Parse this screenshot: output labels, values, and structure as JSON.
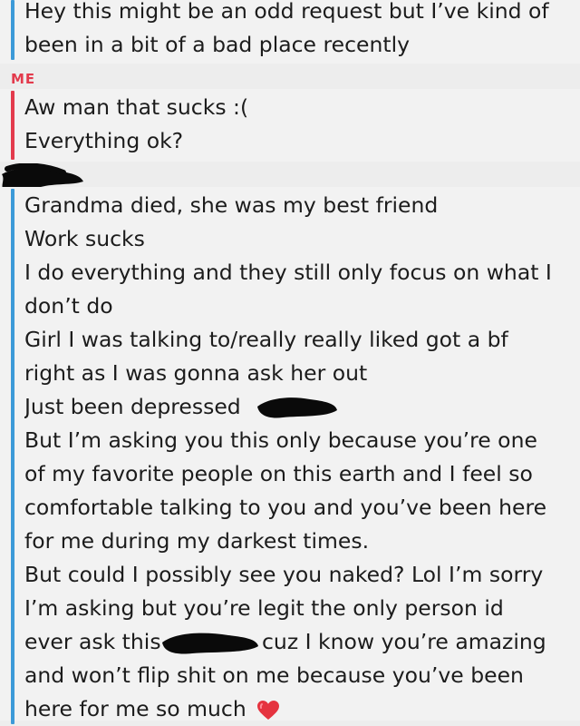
{
  "colors": {
    "them_bar": "#3c9ad8",
    "me_bar": "#e33b4d",
    "me_label": "#e33b4d",
    "background": "#ededed",
    "bubble": "#f2f2f2",
    "text": "#1c1c1c"
  },
  "messages": [
    {
      "sender": "them",
      "lines": [
        "Hey this might be an odd request but I’ve kind of",
        "been in a bit of a bad place recently"
      ]
    },
    {
      "sender": "me",
      "label": "ME",
      "lines": [
        "Aw man that sucks :(",
        "Everything ok?"
      ]
    },
    {
      "sender": "them",
      "lines": [
        "Grandma died, she was my best friend",
        "Work sucks",
        "I do everything and they still only focus on what I",
        "don’t do",
        "Girl I was talking to/really really liked got a bf",
        "right as I was gonna ask her out",
        "Just been depressed",
        "But I’m asking you this only because you’re one",
        "of my favorite people on this earth and I feel so",
        "comfortable talking to you and you’ve been here",
        "for me during my darkest times.",
        "But could I possibly see you naked? Lol I’m sorry",
        "I’m asking but you’re legit the only person id",
        "ever ask this",
        "cuz I know you’re amazing",
        "and won’t flip shit on me because you’ve been",
        "here for me so much"
      ],
      "emoji": "heart-emoji"
    }
  ]
}
